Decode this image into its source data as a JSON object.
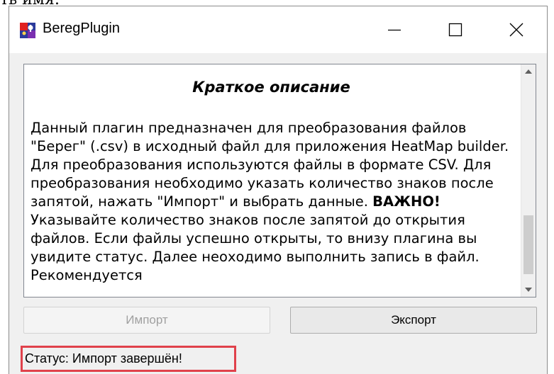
{
  "fragment_text": "ть имя:",
  "window": {
    "title": "BeregPlugin",
    "app_icon": "beregplugin-app-icon",
    "controls": [
      "minimize-icon",
      "maximize-icon",
      "close-icon"
    ]
  },
  "description": {
    "heading": "Краткое описание",
    "paragraph_part1": "Данный плагин предназначен для преобразования файлов \"Берег\" (.csv) в исходный файл для приложения HeatMap builder. Для преобразования используются файлы в формате CSV. Для преобразования необходимо указать количество знаков после запятой, нажать \"Импорт\" и выбрать данные. ",
    "paragraph_bold": "ВАЖНО!",
    "paragraph_part2": " Указывайте количество знаков после запятой до открытия файлов. Если файлы успешно открыты, то внизу плагина вы увидите статус. Далее неоходимо выполнить запись в файл. Рекомендуется"
  },
  "buttons": {
    "import_label": "Импорт",
    "import_enabled": false,
    "export_label": "Экспорт"
  },
  "status": {
    "text": "Статус: Импорт завершён!",
    "highlight_color": "#e0414b"
  }
}
